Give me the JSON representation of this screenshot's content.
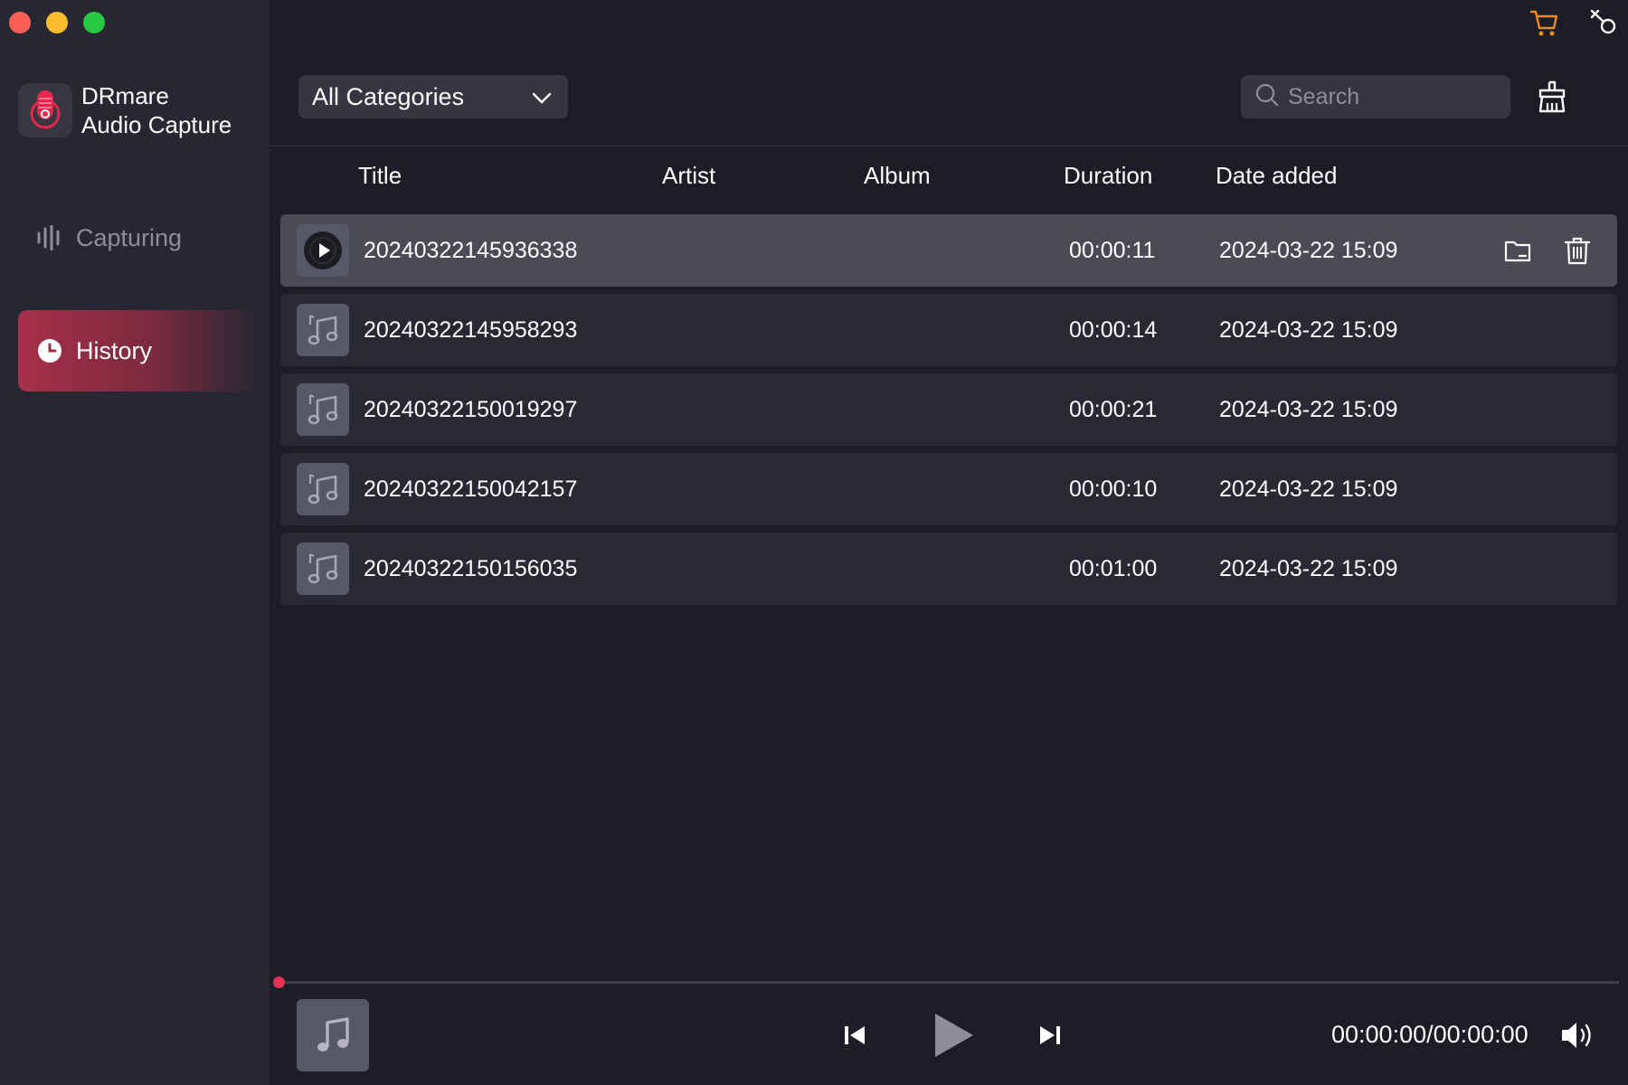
{
  "app": {
    "name_line1": "DRmare",
    "name_line2": "Audio Capture"
  },
  "sidebar": {
    "items": [
      {
        "label": "Capturing",
        "icon": "waveform-icon",
        "active": false
      },
      {
        "label": "History",
        "icon": "clock-icon",
        "active": true
      }
    ]
  },
  "toolbar": {
    "category_selected": "All Categories",
    "search_placeholder": "Search",
    "icons": [
      "cart-icon",
      "pin-icon",
      "clean-icon"
    ],
    "accent_color": "#f08a24"
  },
  "table": {
    "columns": [
      "Title",
      "Artist",
      "Album",
      "Duration",
      "Date added"
    ],
    "rows": [
      {
        "title": "20240322145936338",
        "artist": "",
        "album": "",
        "duration": "00:00:11",
        "date": "2024-03-22 15:09",
        "selected": true
      },
      {
        "title": "20240322145958293",
        "artist": "",
        "album": "",
        "duration": "00:00:14",
        "date": "2024-03-22 15:09",
        "selected": false
      },
      {
        "title": "20240322150019297",
        "artist": "",
        "album": "",
        "duration": "00:00:21",
        "date": "2024-03-22 15:09",
        "selected": false
      },
      {
        "title": "20240322150042157",
        "artist": "",
        "album": "",
        "duration": "00:00:10",
        "date": "2024-03-22 15:09",
        "selected": false
      },
      {
        "title": "20240322150156035",
        "artist": "",
        "album": "",
        "duration": "00:01:00",
        "date": "2024-03-22 15:09",
        "selected": false
      }
    ]
  },
  "player": {
    "time": "00:00:00/00:00:00",
    "progress": 0,
    "accent_color": "#e23357"
  }
}
